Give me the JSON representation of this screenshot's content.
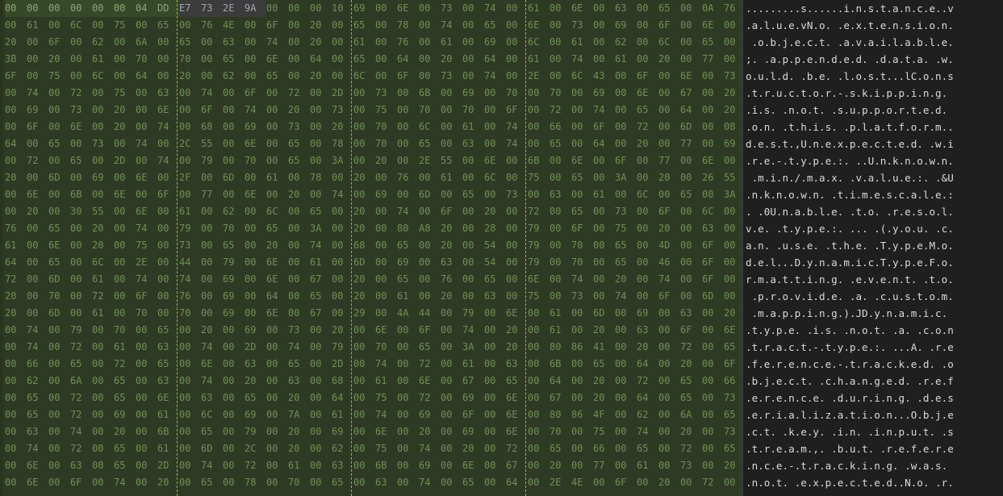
{
  "hex_rows": [
    "00 00 00 00 00 00 04 DD E7 73 2E 9A 00 00 00 10 69 00 6E 00 73 00 74 00 61 00 6E 00 63 00 65 00 0A 76",
    "00 61 00 6C 00 75 00 65 00 76 4E 00 6F 00 20 00 65 00 78 00 74 00 65 00 6E 00 73 00 69 00 6F 00 6E 00",
    "20 00 6F 00 62 00 6A 00 65 00 63 00 74 00 20 00 61 00 76 00 61 00 69 00 6C 00 61 00 62 00 6C 00 65 00",
    "3B 00 20 00 61 00 70 00 70 00 65 00 6E 00 64 00 65 00 64 00 20 00 64 00 61 00 74 00 61 00 20 00 77 00",
    "6F 00 75 00 6C 00 64 00 20 00 62 00 65 00 20 00 6C 00 6F 00 73 00 74 00 2E 00 6C 43 00 6F 00 6E 00 73",
    "00 74 00 72 00 75 00 63 00 74 00 6F 00 72 00 2D 00 73 00 6B 00 69 00 70 00 70 00 69 00 6E 00 67 00 20",
    "00 69 00 73 00 20 00 6E 00 6F 00 74 00 20 00 73 00 75 00 70 00 70 00 6F 00 72 00 74 00 65 00 64 00 20",
    "00 6F 00 6E 00 20 00 74 00 68 00 69 00 73 00 20 00 70 00 6C 00 61 00 74 00 66 00 6F 00 72 00 6D 00 08",
    "64 00 65 00 73 00 74 00 2C 55 00 6E 00 65 00 78 00 70 00 65 00 63 00 74 00 65 00 64 00 20 00 77 00 69",
    "00 72 00 65 00 2D 00 74 00 79 00 70 00 65 00 3A 00 20 00 2E 55 00 6E 00 6B 00 6E 00 6F 00 77 00 6E 00",
    "20 00 6D 00 69 00 6E 00 2F 00 6D 00 61 00 78 00 20 00 76 00 61 00 6C 00 75 00 65 00 3A 00 20 00 26 55",
    "00 6E 00 6B 00 6E 00 6F 00 77 00 6E 00 20 00 74 00 69 00 6D 00 65 00 73 00 63 00 61 00 6C 00 65 00 3A",
    "00 20 00 30 55 00 6E 00 61 00 62 00 6C 00 65 00 20 00 74 00 6F 00 20 00 72 00 65 00 73 00 6F 00 6C 00",
    "76 00 65 00 20 00 74 00 79 00 70 00 65 00 3A 00 20 00 80 A8 20 00 28 00 79 00 6F 00 75 00 20 00 63 00",
    "61 00 6E 00 20 00 75 00 73 00 65 00 20 00 74 00 68 00 65 00 20 00 54 00 79 00 70 00 65 00 4D 00 6F 00",
    "64 00 65 00 6C 00 2E 00 44 00 79 00 6E 00 61 00 6D 00 69 00 63 00 54 00 79 00 70 00 65 00 46 00 6F 00",
    "72 00 6D 00 61 00 74 00 74 00 69 00 6E 00 67 00 20 00 65 00 76 00 65 00 6E 00 74 00 20 00 74 00 6F 00",
    "20 00 70 00 72 00 6F 00 76 00 69 00 64 00 65 00 20 00 61 00 20 00 63 00 75 00 73 00 74 00 6F 00 6D 00",
    "20 00 6D 00 61 00 70 00 70 00 69 00 6E 00 67 00 29 00 4A 44 00 79 00 6E 00 61 00 6D 00 69 00 63 00 20",
    "00 74 00 79 00 70 00 65 00 20 00 69 00 73 00 20 00 6E 00 6F 00 74 00 20 00 61 00 20 00 63 00 6F 00 6E",
    "00 74 00 72 00 61 00 63 00 74 00 2D 00 74 00 79 00 70 00 65 00 3A 00 20 00 80 86 41 00 20 00 72 00 65",
    "00 66 00 65 00 72 00 65 00 6E 00 63 00 65 00 2D 00 74 00 72 00 61 00 63 00 6B 00 65 00 64 00 20 00 6F",
    "00 62 00 6A 00 65 00 63 00 74 00 20 00 63 00 68 00 61 00 6E 00 67 00 65 00 64 00 20 00 72 00 65 00 66",
    "00 65 00 72 00 65 00 6E 00 63 00 65 00 20 00 64 00 75 00 72 00 69 00 6E 00 67 00 20 00 64 00 65 00 73",
    "00 65 00 72 00 69 00 61 00 6C 00 69 00 7A 00 61 00 74 00 69 00 6F 00 6E 00 80 86 4F 00 62 00 6A 00 65",
    "00 63 00 74 00 20 00 6B 00 65 00 79 00 20 00 69 00 6E 00 20 00 69 00 6E 00 70 00 75 00 74 00 20 00 73",
    "00 74 00 72 00 65 00 61 00 6D 00 2C 00 20 00 62 00 75 00 74 00 20 00 72 00 65 00 66 00 65 00 72 00 65",
    "00 6E 00 63 00 65 00 2D 00 74 00 72 00 61 00 63 00 6B 00 69 00 6E 00 67 00 20 00 77 00 61 00 73 00 20",
    "00 6E 00 6F 00 74 00 20 00 65 00 78 00 70 00 65 00 63 00 74 00 65 00 64 00 2E 4E 00 6F 00 20 00 72 00"
  ],
  "ascii_rows": [
    ".........s......i.n.s.t.a.n.c.e..v",
    ".a.l.u.e.vN.o. .e.x.t.e.n.s.i.o.n.",
    " .o.b.j.e.c.t. .a.v.a.i.l.a.b.l.e.",
    ";. .a.p.p.e.n.d.e.d. .d.a.t.a. .w.",
    "o.u.l.d. .b.e. .l.o.s.t...lC.o.n.s",
    ".t.r.u.c.t.o.r.-.s.k.i.p.p.i.n.g. ",
    ".i.s. .n.o.t. .s.u.p.p.o.r.t.e.d. ",
    ".o.n. .t.h.i.s. .p.l.a.t.f.o.r.m..",
    "d.e.s.t.,U.n.e.x.p.e.c.t.e.d. .w.i",
    ".r.e.-.t.y.p.e.:. ..U.n.k.n.o.w.n.",
    " .m.i.n./.m.a.x. .v.a.l.u.e.:. .&U",
    ".n.k.n.o.w.n. .t.i.m.e.s.c.a.l.e.:",
    ". .0U.n.a.b.l.e. .t.o. .r.e.s.o.l.",
    "v.e. .t.y.p.e.:. ... .(.y.o.u. .c.",
    "a.n. .u.s.e. .t.h.e. .T.y.p.e.M.o.",
    "d.e.l...D.y.n.a.m.i.c.T.y.p.e.F.o.",
    "r.m.a.t.t.i.n.g. .e.v.e.n.t. .t.o.",
    " .p.r.o.v.i.d.e. .a. .c.u.s.t.o.m.",
    " .m.a.p.p.i.n.g.).JD.y.n.a.m.i.c. ",
    ".t.y.p.e. .i.s. .n.o.t. .a. .c.o.n",
    ".t.r.a.c.t.-.t.y.p.e.:. ...A. .r.e",
    ".f.e.r.e.n.c.e.-.t.r.a.c.k.e.d. .o",
    ".b.j.e.c.t. .c.h.a.n.g.e.d. .r.e.f",
    ".e.r.e.n.c.e. .d.u.r.i.n.g. .d.e.s",
    ".e.r.i.a.l.i.z.a.t.i.o.n...O.b.j.e",
    ".c.t. .k.e.y. .i.n. .i.n.p.u.t. .s",
    ".t.r.e.a.m.,. .b.u.t. .r.e.f.e.r.e",
    ".n.c.e.-.t.r.a.c.k.i.n.g. .w.a.s. ",
    ".n.o.t. .e.x.p.e.c.t.e.d..N.o. .r."
  ],
  "colors": {
    "hex_background": "#2f3a24",
    "hex_text": "#6f8f57",
    "selected_range_background": "#364a2a",
    "ascii_background": "#1f1f1f",
    "ascii_text": "#d9d9d9",
    "group_separator": "#b3a64a"
  }
}
